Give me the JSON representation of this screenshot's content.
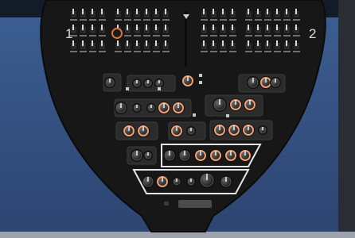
{
  "panel": {
    "left_label": "1",
    "right_label": "2"
  },
  "colors": {
    "sky_top": "#3d5f93",
    "sky_bottom": "#2c4470",
    "panel_body": "#171717",
    "panel_edge": "#0b0b0b",
    "knob_ring": "#f0a070",
    "highlight_box": "#e6e6e6",
    "label_text": "#d8d8d8"
  },
  "icons": {
    "knob": "rotary-knob-icon",
    "switch": "toggle-switch-icon",
    "indicator": "indicator-light-icon"
  }
}
